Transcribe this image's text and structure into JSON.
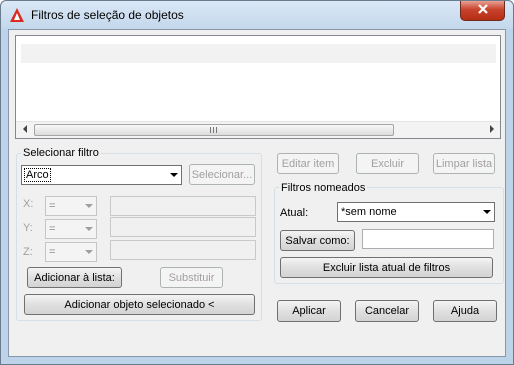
{
  "window": {
    "title": "Filtros de seleção de objetos"
  },
  "filter": {
    "group_label": "Selecionar filtro",
    "type_value": "Arco",
    "select_button": "Selecionar...",
    "x_label": "X:",
    "y_label": "Y:",
    "z_label": "Z:",
    "operator_value": "=",
    "add_to_list_button": "Adicionar à lista:",
    "substitute_button": "Substituir",
    "add_selected_button": "Adicionar objeto selecionado <"
  },
  "list_actions": {
    "edit_button": "Editar item",
    "delete_button": "Excluir",
    "clear_button": "Limpar lista"
  },
  "named_filters": {
    "group_label": "Filtros nomeados",
    "current_label": "Atual:",
    "current_value": "*sem nome",
    "save_as_button": "Salvar como:",
    "save_as_value": "",
    "delete_current_button": "Excluir lista atual de filtros"
  },
  "dialog_buttons": {
    "apply": "Aplicar",
    "cancel": "Cancelar",
    "help": "Ajuda"
  },
  "colors": {
    "title_bar": "#c3d7ec",
    "close_button": "#c7432c",
    "app_icon": "#d82c20"
  }
}
